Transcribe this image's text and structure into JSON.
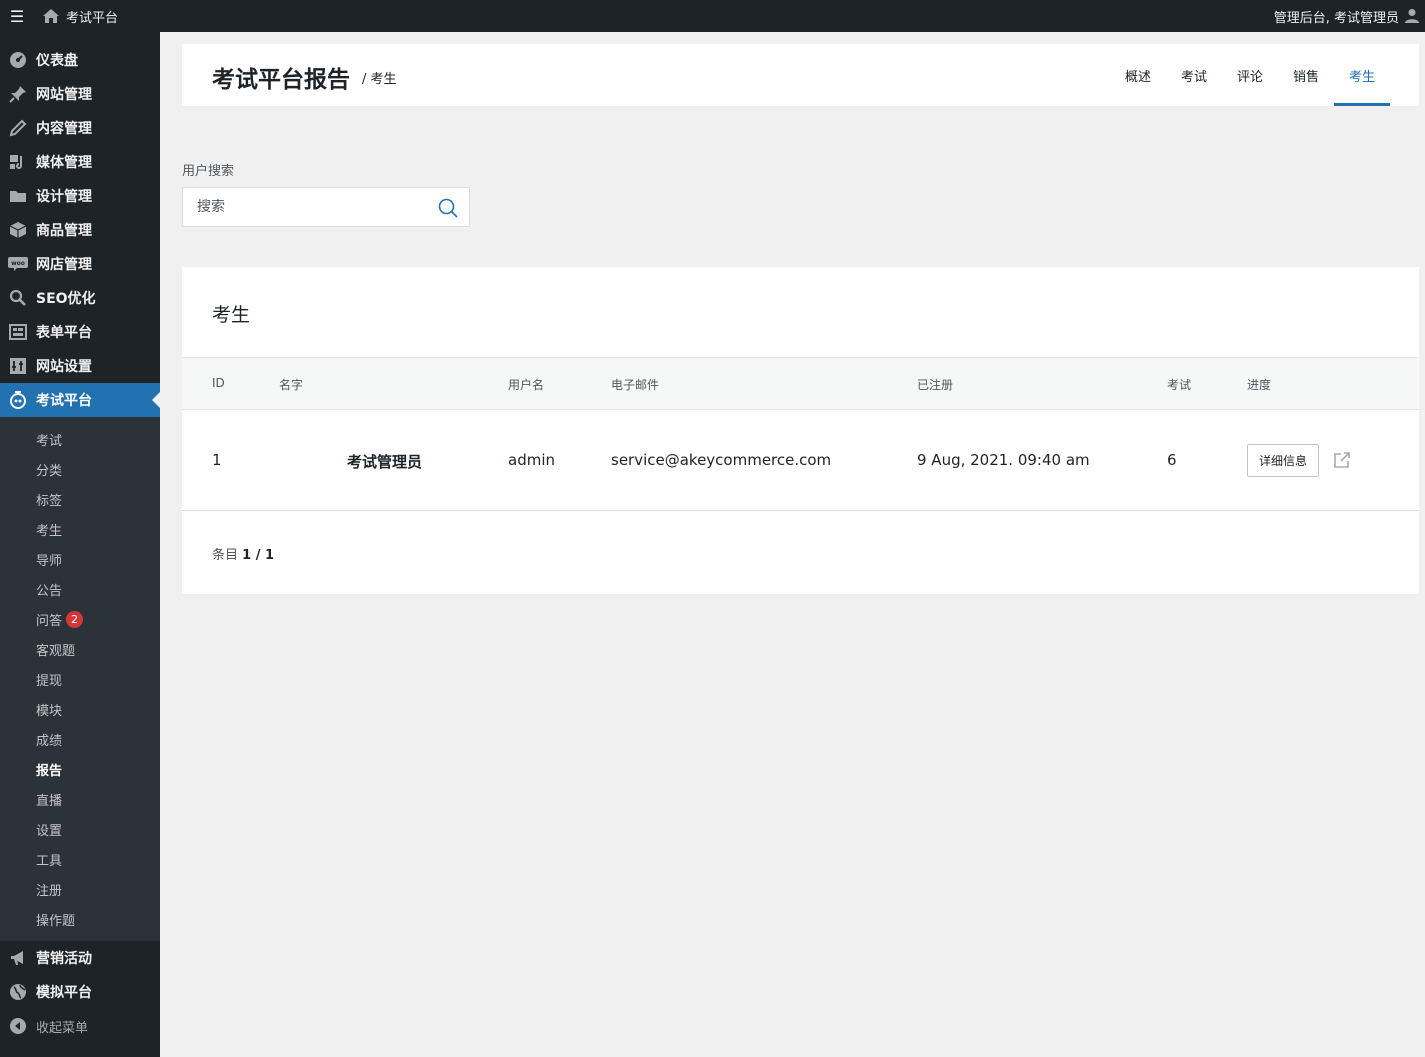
{
  "adminbar": {
    "menu_icon": "☰",
    "site_name": "考试平台",
    "right_text": "管理后台, 考试管理员"
  },
  "sidebar": {
    "items_top": [
      {
        "label": "仪表盘",
        "icon": "dashboard-icon"
      },
      {
        "label": "网站管理",
        "icon": "pin-icon"
      },
      {
        "label": "内容管理",
        "icon": "pencil-icon"
      },
      {
        "label": "媒体管理",
        "icon": "media-icon"
      },
      {
        "label": "设计管理",
        "icon": "folder-icon"
      },
      {
        "label": "商品管理",
        "icon": "box-icon"
      },
      {
        "label": "网店管理",
        "icon": "woo-icon"
      },
      {
        "label": "SEO优化",
        "icon": "search-icon"
      },
      {
        "label": "表单平台",
        "icon": "form-icon"
      },
      {
        "label": "网站设置",
        "icon": "settings-icon"
      },
      {
        "label": "考试平台",
        "icon": "exam-icon"
      }
    ],
    "submenu": [
      {
        "label": "考试"
      },
      {
        "label": "分类"
      },
      {
        "label": "标签"
      },
      {
        "label": "考生"
      },
      {
        "label": "导师"
      },
      {
        "label": "公告"
      },
      {
        "label": "问答",
        "badge": "2"
      },
      {
        "label": "客观题"
      },
      {
        "label": "提现"
      },
      {
        "label": "模块"
      },
      {
        "label": "成绩"
      },
      {
        "label": "报告"
      },
      {
        "label": "直播"
      },
      {
        "label": "设置"
      },
      {
        "label": "工具"
      },
      {
        "label": "注册"
      },
      {
        "label": "操作题"
      }
    ],
    "items_bottom": [
      {
        "label": "营销活动",
        "icon": "megaphone-icon"
      },
      {
        "label": "模拟平台",
        "icon": "globe-icon"
      }
    ],
    "collapse_label": "收起菜单"
  },
  "header": {
    "title": "考试平台报告",
    "breadcrumb": "/ 考生",
    "tabs": [
      {
        "label": "概述"
      },
      {
        "label": "考试"
      },
      {
        "label": "评论"
      },
      {
        "label": "销售"
      },
      {
        "label": "考生"
      }
    ]
  },
  "search": {
    "label": "用户搜索",
    "placeholder": "搜索"
  },
  "students": {
    "title": "考生",
    "columns": [
      "ID",
      "名字",
      "用户名",
      "电子邮件",
      "已注册",
      "考试",
      "进度"
    ],
    "rows": [
      {
        "id": "1",
        "name": "考试管理员",
        "username": "admin",
        "email": "service@akeycommerce.com",
        "registered": "9 Aug, 2021. 09:40 am",
        "exams": "6",
        "detail_label": "详细信息"
      }
    ],
    "pager_prefix": "条目",
    "pager_value": "1 / 1"
  }
}
